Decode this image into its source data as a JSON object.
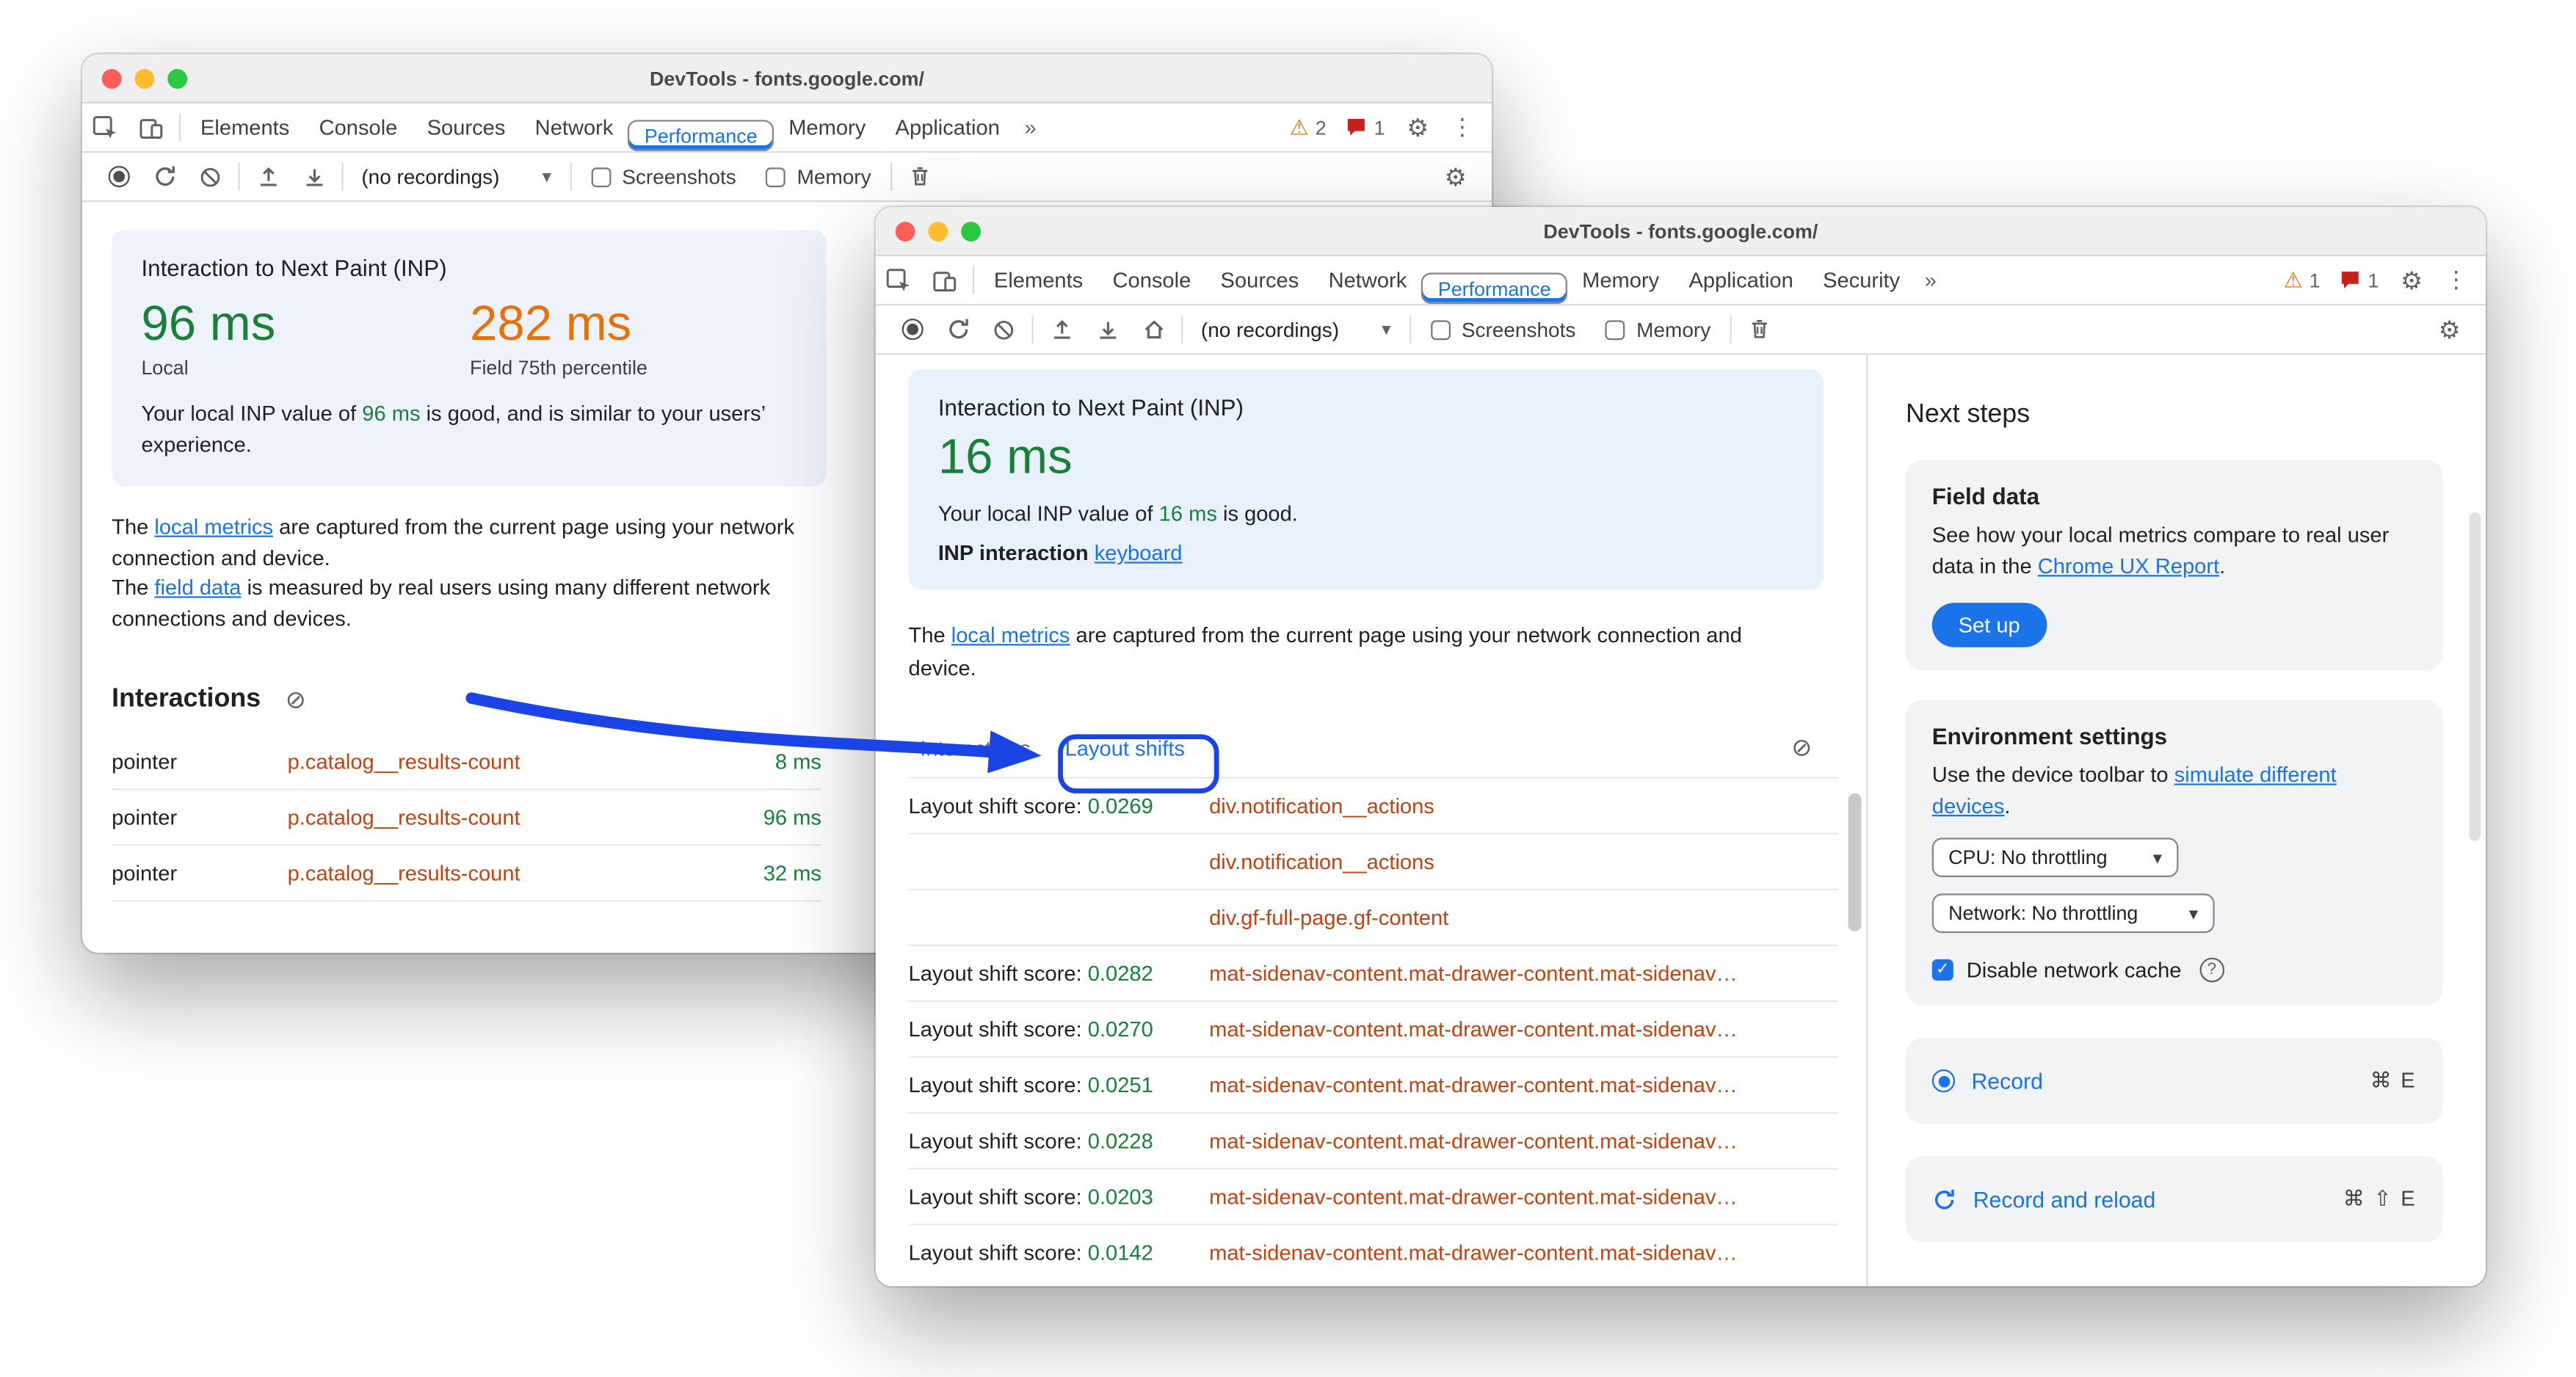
{
  "colors": {
    "accent_blue": "#1a73e8",
    "metric_green": "#188038",
    "metric_orange": "#e8710a",
    "node_link_orange": "#c5410f",
    "annotation_blue": "#1b44e6"
  },
  "icons": {
    "warning": "⚠",
    "gear": "⚙",
    "kebab": "⋮",
    "chevron_down": "▾",
    "overflow": "»",
    "block": "⊘",
    "check": "✓",
    "help": "?"
  },
  "left_window": {
    "titlebar": {
      "title": "DevTools - fonts.google.com/"
    },
    "tabs": {
      "items": [
        "Elements",
        "Console",
        "Sources",
        "Network",
        "Performance",
        "Memory",
        "Application"
      ],
      "warning_count": "2",
      "issue_count": "1"
    },
    "toolbar": {
      "recordings": "(no recordings)",
      "screenshots": "Screenshots",
      "memory": "Memory"
    },
    "inp_card": {
      "title": "Interaction to Next Paint (INP)",
      "local_value": "96 ms",
      "local_label": "Local",
      "field_value": "282 ms",
      "field_label": "Field 75th percentile",
      "note_prefix": "Your local INP value of ",
      "note_value": "96 ms",
      "note_suffix": " is good, and is similar to your users’ experience."
    },
    "metrics_note": {
      "line1_prefix": "The ",
      "line1_link": "local metrics",
      "line1_suffix": " are captured from the current page using your network connection and device.",
      "line2_prefix": "The ",
      "line2_link": "field data",
      "line2_suffix": " is measured by real users using many different network connections and devices."
    },
    "interactions": {
      "heading": "Interactions",
      "rows": [
        {
          "type": "pointer",
          "target": "p.catalog__results-count",
          "duration": "8 ms"
        },
        {
          "type": "pointer",
          "target": "p.catalog__results-count",
          "duration": "96 ms"
        },
        {
          "type": "pointer",
          "target": "p.catalog__results-count",
          "duration": "32 ms"
        }
      ]
    }
  },
  "right_window": {
    "titlebar": {
      "title": "DevTools - fonts.google.com/"
    },
    "tabs": {
      "items": [
        "Elements",
        "Console",
        "Sources",
        "Network",
        "Performance",
        "Memory",
        "Application",
        "Security"
      ],
      "warning_count": "1",
      "issue_count": "1"
    },
    "toolbar": {
      "recordings": "(no recordings)",
      "screenshots": "Screenshots",
      "memory": "Memory"
    },
    "inp_card": {
      "title": "Interaction to Next Paint (INP)",
      "value": "16 ms",
      "note_prefix": "Your local INP value of ",
      "note_value": "16 ms",
      "note_suffix": " is good.",
      "interaction_label": "INP interaction",
      "interaction_link": "keyboard"
    },
    "metrics_note": {
      "prefix": "The ",
      "link": "local metrics",
      "suffix": " are captured from the current page using your network connection and device."
    },
    "results_tabs": {
      "interactions": "Interactions",
      "layout_shifts": "Layout shifts"
    },
    "layout_shifts": {
      "rows": [
        {
          "label": "Layout shift score: ",
          "score": "0.0269",
          "node": "div.notification__actions"
        },
        {
          "label": "",
          "score": "",
          "node": "div.notification__actions"
        },
        {
          "label": "",
          "score": "",
          "node": "div.gf-full-page.gf-content"
        },
        {
          "label": "Layout shift score: ",
          "score": "0.0282",
          "node": "mat-sidenav-content.mat-drawer-content.mat-sidenav…"
        },
        {
          "label": "Layout shift score: ",
          "score": "0.0270",
          "node": "mat-sidenav-content.mat-drawer-content.mat-sidenav…"
        },
        {
          "label": "Layout shift score: ",
          "score": "0.0251",
          "node": "mat-sidenav-content.mat-drawer-content.mat-sidenav…"
        },
        {
          "label": "Layout shift score: ",
          "score": "0.0228",
          "node": "mat-sidenav-content.mat-drawer-content.mat-sidenav…"
        },
        {
          "label": "Layout shift score: ",
          "score": "0.0203",
          "node": "mat-sidenav-content.mat-drawer-content.mat-sidenav…"
        },
        {
          "label": "Layout shift score: ",
          "score": "0.0142",
          "node": "mat-sidenav-content.mat-drawer-content.mat-sidenav…"
        }
      ]
    },
    "next_steps": {
      "heading": "Next steps",
      "field_data": {
        "title": "Field data",
        "text_prefix": "See how your local metrics compare to real user data in the ",
        "link": "Chrome UX Report",
        "text_suffix": ".",
        "button": "Set up"
      },
      "environment": {
        "title": "Environment settings",
        "text_prefix": "Use the device toolbar to ",
        "link": "simulate different devices",
        "text_suffix": ".",
        "cpu_select": "CPU: No throttling",
        "network_select": "Network: No throttling",
        "cache_label": "Disable network cache"
      },
      "record": {
        "label": "Record",
        "shortcut": "⌘ E"
      },
      "record_reload": {
        "label": "Record and reload",
        "shortcut": "⌘ ⇧ E"
      }
    }
  }
}
